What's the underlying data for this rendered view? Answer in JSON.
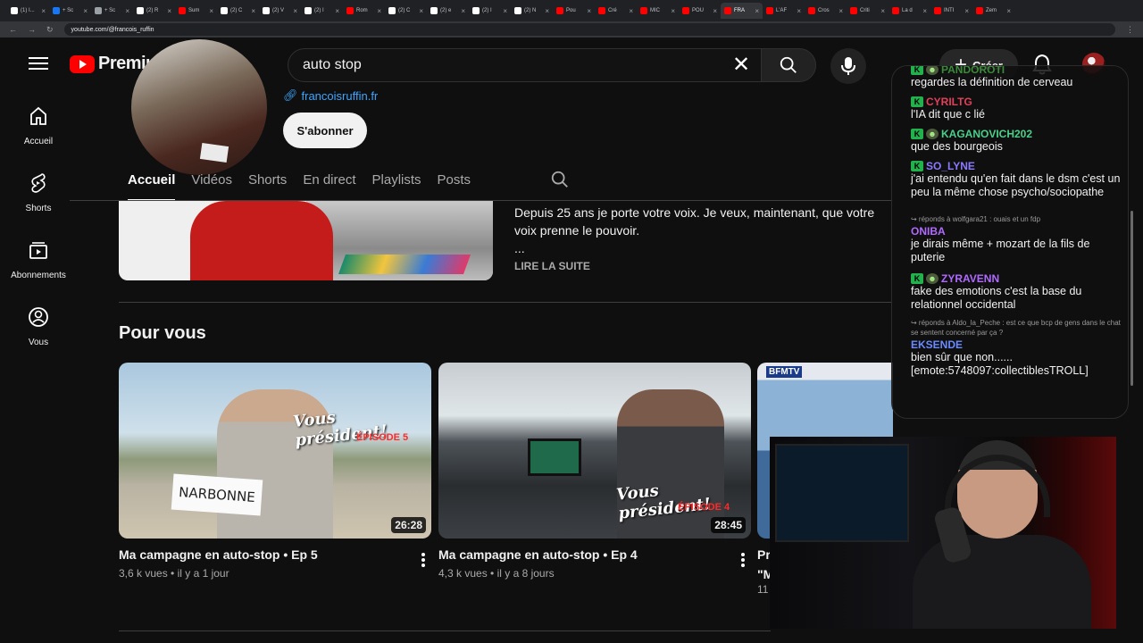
{
  "browser": {
    "url": "youtube.com/@francois_ruffin",
    "tabs": [
      {
        "label": "(1) I...",
        "color": "#ffffff"
      },
      {
        "label": "+ Sc",
        "color": "#1877f2"
      },
      {
        "label": "+ Sc",
        "color": "#9aa0a6"
      },
      {
        "label": "(2) R",
        "color": "#ffffff"
      },
      {
        "label": "Sum",
        "color": "#ff0000"
      },
      {
        "label": "(2) C",
        "color": "#ffffff"
      },
      {
        "label": "(2) V",
        "color": "#ffffff"
      },
      {
        "label": "(2) I",
        "color": "#ffffff"
      },
      {
        "label": "Rom",
        "color": "#ff0000"
      },
      {
        "label": "(2) C",
        "color": "#ffffff"
      },
      {
        "label": "(2) e",
        "color": "#ffffff"
      },
      {
        "label": "(2) I",
        "color": "#ffffff"
      },
      {
        "label": "(2) N",
        "color": "#ffffff"
      },
      {
        "label": "Pou",
        "color": "#ff0000"
      },
      {
        "label": "Cré",
        "color": "#ff0000"
      },
      {
        "label": "MIC",
        "color": "#ff0000"
      },
      {
        "label": "POU",
        "color": "#ff0000"
      },
      {
        "label": "FRA",
        "color": "#ff0000",
        "active": true
      },
      {
        "label": "L'AF",
        "color": "#ff0000"
      },
      {
        "label": "Cros",
        "color": "#ff0000"
      },
      {
        "label": "Criti",
        "color": "#ff0000"
      },
      {
        "label": "La d",
        "color": "#ff0000"
      },
      {
        "label": "INTI",
        "color": "#ff0000"
      },
      {
        "label": "Zem",
        "color": "#ff0000"
      }
    ]
  },
  "masthead": {
    "logo_text": "Premium",
    "logo_sup": "FR",
    "search_value": "auto stop",
    "create_label": "Créer"
  },
  "guide": [
    {
      "label": "Accueil",
      "icon": "home-icon"
    },
    {
      "label": "Shorts",
      "icon": "shorts-icon"
    },
    {
      "label": "Abonnements",
      "icon": "subscriptions-icon"
    },
    {
      "label": "Vous",
      "icon": "you-icon"
    }
  ],
  "channel": {
    "link": "francoisruffin.fr",
    "subscribe_label": "S'abonner",
    "tabs": [
      "Accueil",
      "Vidéos",
      "Shorts",
      "En direct",
      "Playlists",
      "Posts"
    ],
    "active_tab": "Accueil",
    "featured_description": "Depuis 25 ans je porte votre voix. Je veux, maintenant, que votre voix prenne le pouvoir.",
    "featured_ellipsis": "...",
    "read_more": "LIRE LA SUITE"
  },
  "section": {
    "title": "Pour vous",
    "videos": [
      {
        "title": "Ma campagne en auto-stop • Ep 5",
        "views": "3,6 k vues",
        "age": "il y a 1 jour",
        "duration": "26:28",
        "overlay": "Vous président!",
        "episode": "ÉPISODE 5",
        "sign": "NARBONNE"
      },
      {
        "title": "Ma campagne en auto-stop • Ep 4",
        "views": "4,3 k vues",
        "age": "il y a 8 jours",
        "duration": "28:45",
        "overlay": "Vous président!",
        "episode": "ÉPISODE 4"
      },
      {
        "title": "Pr",
        "title2": "\"M",
        "meta": "11",
        "channel_badge": "BFMTV"
      }
    ]
  },
  "chat": {
    "messages": [
      {
        "name": "PANDOROTI",
        "color": "#3a8a3a",
        "badges": [
          "k",
          "g"
        ],
        "text": "regardes la définition de cerveau"
      },
      {
        "name": "CYRILTG",
        "color": "#e0405a",
        "badges": [
          "k"
        ],
        "text": "l'IA dit que c lié"
      },
      {
        "name": "KAGANOVICH202",
        "color": "#4ad08a",
        "badges": [
          "k",
          "g"
        ],
        "text": "que des bourgeois"
      },
      {
        "name": "SO_LYNE",
        "color": "#8a7aff",
        "badges": [
          "k"
        ],
        "text": "j'ai entendu qu'en fait dans le dsm c'est un peu la même chose psycho/sociopathe"
      },
      {
        "reply": "↪ réponds à wolfgara21 : ouais et un fdp",
        "name": "ONIBA",
        "color": "#b06aff",
        "badges": [],
        "text": "je dirais même + mozart de la fils de puterie"
      },
      {
        "name": "ZYRAVENN",
        "color": "#b06aff",
        "badges": [
          "k",
          "g"
        ],
        "text": "fake des emotions c'est la base du relationnel occidental"
      },
      {
        "reply": "↪ réponds à Aldo_la_Peche : est ce que bcp de gens dans le chat se sentent concerné par ça ?",
        "name": "EKSENDE",
        "color": "#6a8aff",
        "badges": [],
        "text": "bien sûr que non...... [emote:5748097:collectiblesTROLL]"
      }
    ]
  }
}
